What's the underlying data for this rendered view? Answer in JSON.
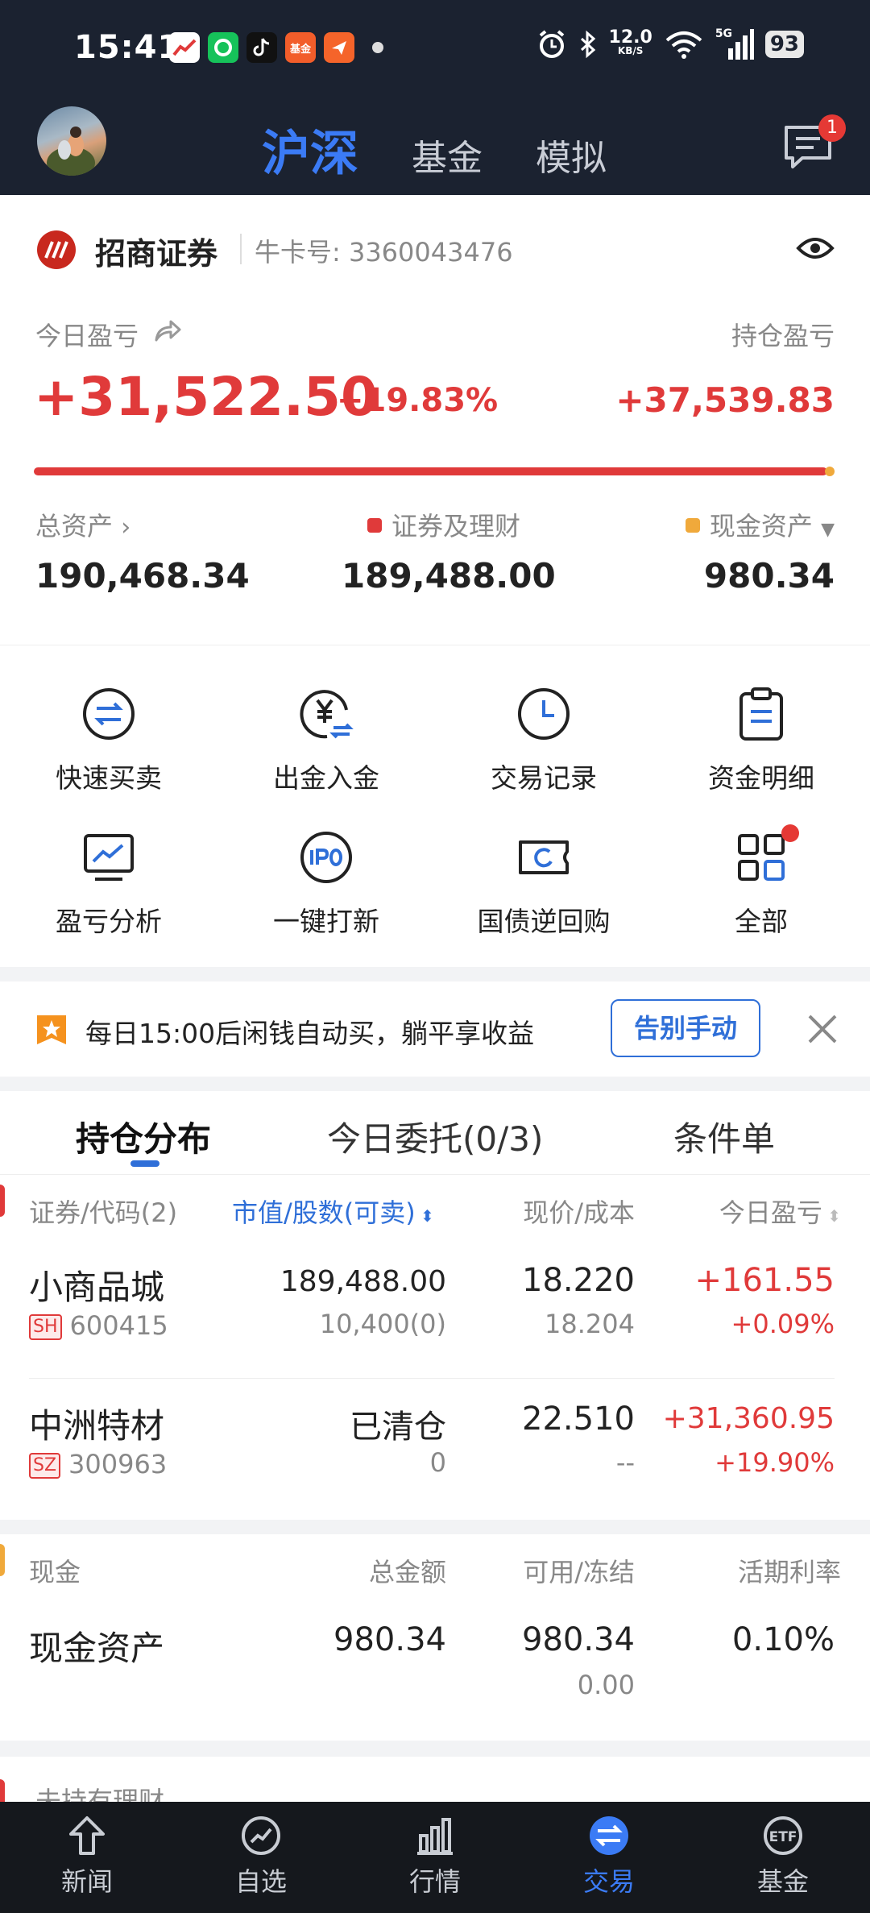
{
  "status_bar": {
    "time": "15:41",
    "net_speed_value": "12.0",
    "net_speed_unit": "KB/S",
    "network": "5G",
    "battery": "93",
    "app_icon_label": "基金"
  },
  "top_nav": {
    "tabs": [
      "沪深",
      "基金",
      "模拟"
    ],
    "active_tab": 0,
    "message_badge": "1"
  },
  "account": {
    "broker_name": "招商证券",
    "card_label": "牛卡号: 3360043476",
    "today_pnl_label": "今日盈亏",
    "today_pnl": "+31,522.50",
    "today_pnl_pct": "+19.83%",
    "holding_pnl_label": "持仓盈亏",
    "holding_pnl": "+37,539.83",
    "securities_ratio": 0.995,
    "total_assets_label": "总资产",
    "total_assets": "190,468.34",
    "securities_label": "证券及理财",
    "securities_value": "189,488.00",
    "cash_label": "现金资产",
    "cash_value": "980.34",
    "colors": {
      "securities": "#e03a3a",
      "cash": "#f0a93b",
      "positive": "#e03a3a"
    }
  },
  "functions": [
    {
      "label": "快速买卖",
      "icon": "swap-circle-icon"
    },
    {
      "label": "出金入金",
      "icon": "yuan-transfer-icon"
    },
    {
      "label": "交易记录",
      "icon": "clock-icon"
    },
    {
      "label": "资金明细",
      "icon": "clipboard-icon"
    },
    {
      "label": "盈亏分析",
      "icon": "chart-monitor-icon"
    },
    {
      "label": "一键打新",
      "icon": "ipo-icon"
    },
    {
      "label": "国债逆回购",
      "icon": "ticket-icon"
    },
    {
      "label": "全部",
      "icon": "grid-icon"
    }
  ],
  "banner": {
    "text": "每日15:00后闲钱自动买，躺平享收益",
    "button": "告别手动"
  },
  "position_tabs": {
    "tabs": [
      "持仓分布",
      "今日委托(0/3)",
      "条件单"
    ],
    "active": 0
  },
  "holdings": {
    "headers": [
      "证券/代码(2)",
      "市值/股数(可卖)",
      "现价/成本",
      "今日盈亏"
    ],
    "rows": [
      {
        "name": "小商品城",
        "market": "SH",
        "code": "600415",
        "value": "189,488.00",
        "shares": "10,400(0)",
        "price": "18.220",
        "cost": "18.204",
        "pnl": "+161.55",
        "pnl_pct": "+0.09%"
      },
      {
        "name": "中洲特材",
        "market": "SZ",
        "code": "300963",
        "value": "已清仓",
        "shares": "0",
        "price": "22.510",
        "cost": "--",
        "pnl": "+31,360.95",
        "pnl_pct": "+19.90%"
      }
    ]
  },
  "cash": {
    "headers": [
      "现金",
      "总金额",
      "可用/冻结",
      "活期利率"
    ],
    "name": "现金资产",
    "total": "980.34",
    "available": "980.34",
    "frozen": "0.00",
    "rate": "0.10%"
  },
  "unheld": {
    "title": "未持有理财"
  },
  "bottom_nav": {
    "items": [
      "新闻",
      "自选",
      "行情",
      "交易",
      "基金"
    ],
    "active": 3
  }
}
